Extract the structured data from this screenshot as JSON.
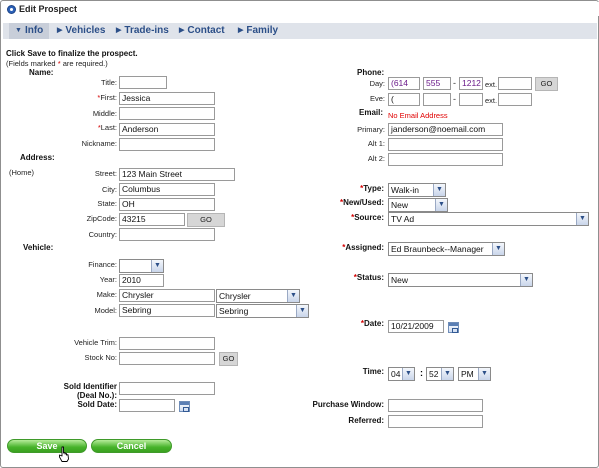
{
  "window": {
    "title": "Edit Prospect"
  },
  "tabs": [
    {
      "label": "Info",
      "active": true
    },
    {
      "label": "Vehicles",
      "active": false
    },
    {
      "label": "Trade-ins",
      "active": false
    },
    {
      "label": "Contact",
      "active": false
    },
    {
      "label": "Family",
      "active": false
    }
  ],
  "intro": {
    "save_note": "Click Save to finalize the prospect.",
    "req_prefix": "(Fields marked ",
    "req_star": "*",
    "req_suffix": " are required.)"
  },
  "name": {
    "heading": "Name:",
    "title_label": "Title:",
    "title_value": "",
    "first_label": "First:",
    "first_value": "Jessica",
    "middle_label": "Middle:",
    "middle_value": "",
    "last_label": "Last:",
    "last_value": "Anderson",
    "nickname_label": "Nickname:",
    "nickname_value": ""
  },
  "address": {
    "heading": "Address:",
    "type": "(Home)",
    "street_label": "Street:",
    "street_value": "123 Main Street",
    "city_label": "City:",
    "city_value": "Columbus",
    "state_label": "State:",
    "state_value": "OH",
    "zip_label": "ZipCode:",
    "zip_value": "43215",
    "go_label": "GO",
    "country_label": "Country:",
    "country_value": ""
  },
  "vehicle": {
    "heading": "Vehicle:",
    "finance_label": "Finance:",
    "finance_value": "",
    "year_label": "Year:",
    "year_value": "2010",
    "make_label": "Make:",
    "make_value": "Chrysler",
    "make_select": "Chrysler",
    "model_label": "Model:",
    "model_value": "Sebring",
    "model_select": "Sebring",
    "trim_label": "Vehicle Trim:",
    "trim_value": "",
    "stock_label": "Stock No:",
    "stock_value": "",
    "go_label": "GO"
  },
  "sold": {
    "identifier_label_1": "Sold Identifier",
    "identifier_label_2": "(Deal No.):",
    "identifier_value": "",
    "date_label": "Sold Date:",
    "date_value": ""
  },
  "phone": {
    "heading": "Phone:",
    "day_label": "Day:",
    "day_area": "(614",
    "day_prefix": "555",
    "day_line": "1212",
    "day_ext_label": "ext.",
    "day_ext": "",
    "go_label": "GO",
    "eve_label": "Eve:",
    "eve_area": "(",
    "eve_prefix": "",
    "eve_line": "",
    "eve_ext_label": "ext.",
    "eve_ext": ""
  },
  "email": {
    "heading": "Email:",
    "error": "No Email Address",
    "primary_label": "Primary:",
    "primary_value": "janderson@noemail.com",
    "alt1_label": "Alt 1:",
    "alt1_value": "",
    "alt2_label": "Alt 2:",
    "alt2_value": ""
  },
  "prospect": {
    "type_label": "Type:",
    "type_value": "Walk-in",
    "newused_label": "New/Used:",
    "newused_value": "New",
    "source_label": "Source:",
    "source_value": "TV Ad",
    "assigned_label": "Assigned:",
    "assigned_value": "Ed Braunbeck--Manager",
    "status_label": "Status:",
    "status_value": "New",
    "date_label": "Date:",
    "date_value": "10/21/2009",
    "time_label": "Time:",
    "time_hour": "04",
    "time_min": "52",
    "time_ampm": "PM",
    "purchase_label": "Purchase Window:",
    "purchase_value": "",
    "referred_label": "Referred:",
    "referred_value": ""
  },
  "actions": {
    "save_label": "Save",
    "cancel_label": "Cancel"
  },
  "colors": {
    "accent": "#2c4f88",
    "tab_bg": "#dfe3ea",
    "required": "#d40000",
    "button_green": "#46b32a"
  }
}
